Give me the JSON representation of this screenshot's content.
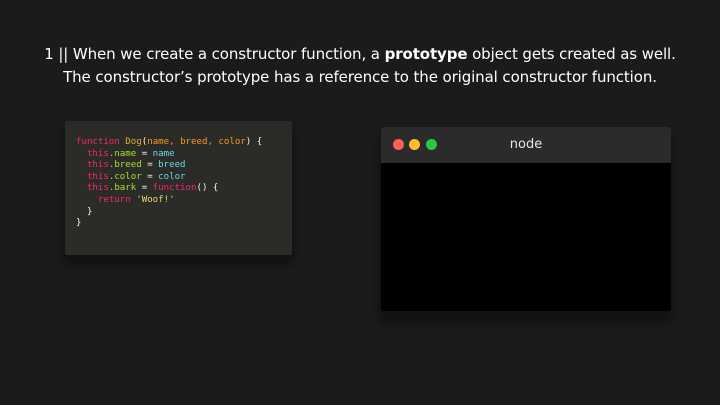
{
  "caption": {
    "line1_pre": "1 || When we create a constructor function, a ",
    "line1_bold": "prototype",
    "line1_post": " object gets created as well.",
    "line2": "The constructor’s prototype has a reference to the original constructor function."
  },
  "code": {
    "l1_kw": "function",
    "l1_name": "Dog",
    "l1_open": "(",
    "l1_params": "name, breed, color",
    "l1_close": ") {",
    "l2_this": "this",
    "l2_prop": ".name",
    "l2_eq": " = ",
    "l2_val": "name",
    "l3_this": "this",
    "l3_prop": ".breed",
    "l3_eq": " = ",
    "l3_val": "breed",
    "l4_this": "this",
    "l4_prop": ".color",
    "l4_eq": " = ",
    "l4_val": "color",
    "l5_this": "this",
    "l5_prop": ".bark",
    "l5_eq": " = ",
    "l5_fn": "function",
    "l5_rest": "() {",
    "l6_kw": "return",
    "l6_str": "'Woof!'",
    "l7": "}",
    "l8": "}"
  },
  "terminal": {
    "title": "node",
    "colors": {
      "close": "#ff5f57",
      "minimize": "#febc2e",
      "maximize": "#28c840"
    }
  }
}
